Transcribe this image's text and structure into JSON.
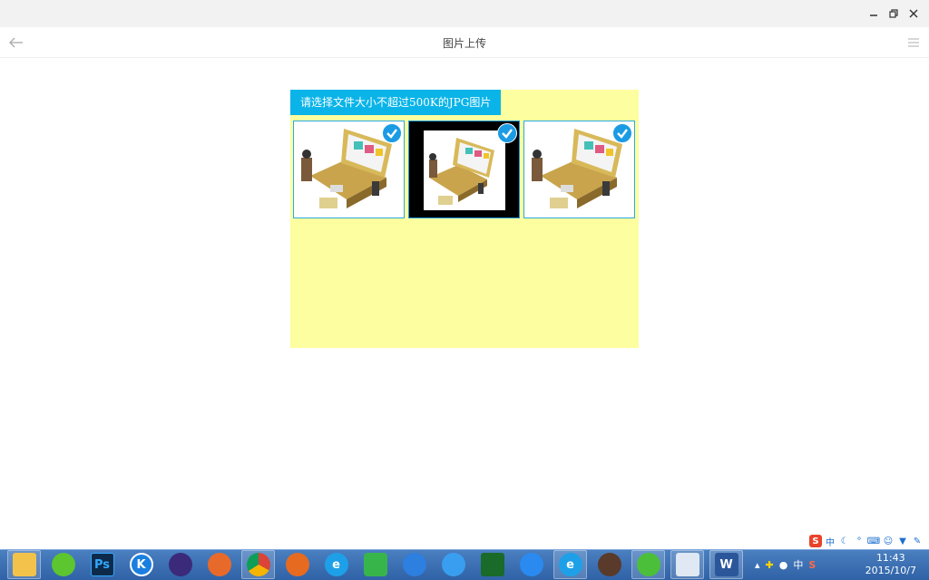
{
  "window": {
    "title": "图片上传"
  },
  "panel": {
    "instruction": "请选择文件大小不超过500K的JPG图片",
    "background_color": "#fdfe9f",
    "accent_color": "#0ab4e8",
    "images": [
      {
        "selected": true,
        "style": "white"
      },
      {
        "selected": true,
        "style": "dark-frame"
      },
      {
        "selected": true,
        "style": "white"
      }
    ]
  },
  "taskbar": {
    "apps": [
      "file-explorer-icon",
      "leaf-app-icon",
      "photoshop-icon",
      "kugou-music-icon",
      "eclipse-icon",
      "game-center-icon",
      "chrome-icon",
      "firefox-icon",
      "internet-explorer-icon",
      "download-app-icon",
      "cloud-app-icon",
      "baidu-cloud-icon",
      "eye-app-icon",
      "pen-app-icon",
      "internet-explorer-alt-icon",
      "game-badge-icon",
      "wechat-icon",
      "remote-desktop-icon",
      "word-icon"
    ],
    "ps_label": "Ps",
    "k_label": "K",
    "word_label": "W",
    "ime_label": "中",
    "sogou_label": "S",
    "time": "11:43",
    "date": "2015/10/7"
  }
}
